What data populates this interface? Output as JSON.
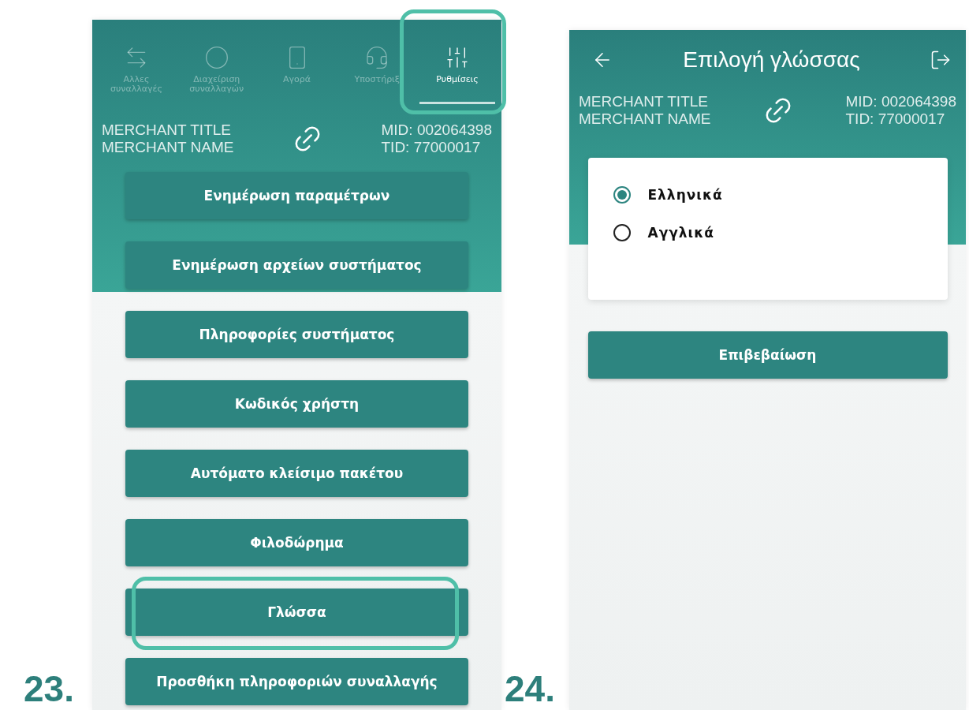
{
  "steps": [
    {
      "number": "23.",
      "screen": {
        "tabs": [
          {
            "label": "Αλλες συναλλαγές",
            "selected": false,
            "kind": "transfer"
          },
          {
            "label": "Διαχείριση συναλλαγών",
            "selected": false,
            "kind": "circle"
          },
          {
            "label": "Αγορά",
            "selected": false,
            "kind": "phone"
          },
          {
            "label": "Υποστήριξ",
            "selected": false,
            "kind": "support"
          },
          {
            "label": "Ρυθμίσεις",
            "selected": true,
            "kind": "settings"
          }
        ],
        "merchant": {
          "title": "MERCHANT TITLE",
          "name": "MERCHANT NAME",
          "mid": "MID: 002064398",
          "tid": "TID: 77000017"
        },
        "buttons": [
          {
            "label": "Ενημέρωση παραμέτρων",
            "highlighted": false
          },
          {
            "label": "Ενημέρωση αρχείων συστήματος",
            "highlighted": false
          },
          {
            "label": "Πληροφορίες συστήματος",
            "highlighted": false
          },
          {
            "label": "Κωδικός χρήστη",
            "highlighted": false
          },
          {
            "label": "Αυτόματο κλείσιμο πακέτου",
            "highlighted": false
          },
          {
            "label": "Φιλοδώρημα",
            "highlighted": false
          },
          {
            "label": "Γλώσσα",
            "highlighted": true
          },
          {
            "label": "Προσθήκη πληροφοριών συναλλαγής",
            "highlighted": false
          }
        ]
      }
    },
    {
      "number": "24.",
      "screen": {
        "title": "Επιλογή γλώσσας",
        "merchant": {
          "title": "MERCHANT TITLE",
          "name": "MERCHANT NAME",
          "mid": "MID: 002064398",
          "tid": "TID: 77000017"
        },
        "options": [
          {
            "label": "Ελληνικά",
            "selected": true
          },
          {
            "label": "Αγγλικά",
            "selected": false
          }
        ],
        "confirm": "Επιβεβαίωση"
      }
    }
  ]
}
